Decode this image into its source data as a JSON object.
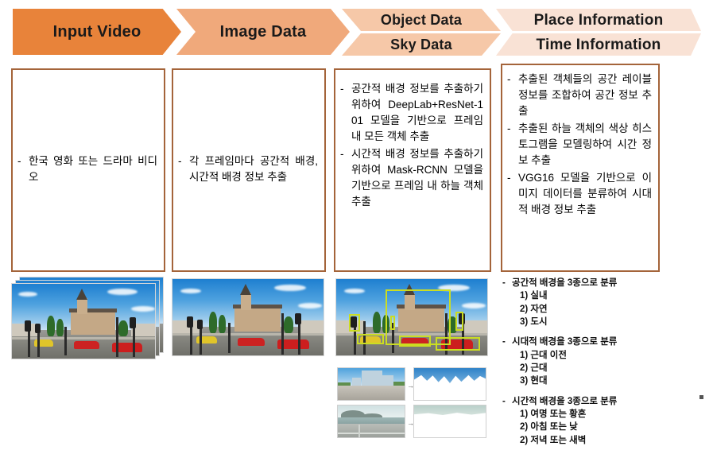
{
  "pipeline": {
    "stages": [
      {
        "id": "input-video",
        "label": "Input Video",
        "color": "#E8833A"
      },
      {
        "id": "image-data",
        "label": "Image Data",
        "color": "#F0A97B"
      },
      {
        "id": "object-data",
        "label": "Object Data",
        "color": "#F6C8A8"
      },
      {
        "id": "sky-data",
        "label": "Sky Data",
        "color": "#F6C8A8"
      },
      {
        "id": "place-information",
        "label": "Place Information",
        "color": "#F9E2D5"
      },
      {
        "id": "time-information",
        "label": "Time Information",
        "color": "#F9E2D5"
      }
    ]
  },
  "boxes": {
    "input_video": {
      "bullets": [
        {
          "dash": "-",
          "text": "한국 영화 또는 드라마 비디오"
        }
      ]
    },
    "image_data": {
      "bullets": [
        {
          "dash": "-",
          "text": "각 프레임마다 공간적 배경, 시간적 배경 정보 추출"
        }
      ]
    },
    "object_sky_data": {
      "bullets": [
        {
          "dash": "-",
          "text": "공간적 배경 정보를 추출하기 위하여 DeepLab+ResNet-101 모델을 기반으로 프레임 내 모든 객체 추출"
        },
        {
          "dash": "-",
          "text": "시간적 배경 정보를 추출하기 위하여 Mask-RCNN 모델을 기반으로 프레임 내 하늘 객체 추출"
        }
      ]
    },
    "place_time_information": {
      "bullets": [
        {
          "dash": "-",
          "text": "추출된 객체들의 공간 레이블 정보를 조합하여 공간 정보 추출"
        },
        {
          "dash": "-",
          "text": "추출된 하늘 객체의 색상 히스토그램을 모델링하여 시간 정보 추출"
        },
        {
          "dash": "-",
          "text": "VGG16 모델을 기반으로 이미지 데이터를 분류하여 시대적 배경 정보 추출"
        }
      ]
    }
  },
  "figures": {
    "input_video": {
      "name": "video-frame-stack",
      "caption": ""
    },
    "image_data": {
      "name": "street-scene-frame",
      "caption": ""
    },
    "object_data": {
      "name": "street-scene-with-detections",
      "caption": "",
      "detection_color": "#CBDD22"
    },
    "sky_data": {
      "name": "sky-extraction-grid",
      "rows": [
        {
          "source": "city-street-photo",
          "mask": "sky-mask-city"
        },
        {
          "source": "seaside-photo",
          "mask": "sky-mask-sea"
        }
      ]
    }
  },
  "classification": {
    "groups": [
      {
        "dash": "-",
        "title": "공간적 배경을 3종으로 분류",
        "items": [
          "1) 실내",
          "2) 자연",
          "3) 도시"
        ]
      },
      {
        "dash": "-",
        "title": "시대적 배경을 3종으로 분류",
        "items": [
          "1) 근대 이전",
          "2) 근대",
          "3) 현대"
        ]
      },
      {
        "dash": "-",
        "title": "시간적 배경을 3종으로 분류",
        "items": [
          "1) 여명 또는 황혼",
          "2) 아침 또는 낮",
          "2) 저녁 또는 새벽"
        ]
      }
    ]
  },
  "colors": {
    "box_border": "#A4643A",
    "accent_strong": "#E8833A",
    "accent_light": "#F9E2D5",
    "detection": "#CBDD22"
  }
}
